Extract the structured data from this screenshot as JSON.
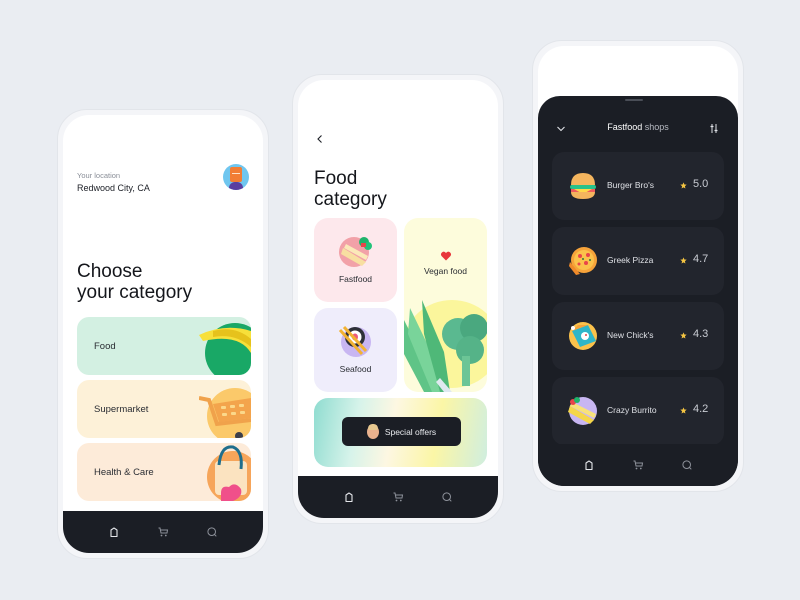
{
  "screens": {
    "home": {
      "location_label": "Your location",
      "location_value": "Redwood City, CA",
      "title_line1": "Choose",
      "title_line2": "your category",
      "categories": [
        {
          "label": "Food",
          "color": "#d3f0e2"
        },
        {
          "label": "Supermarket",
          "color": "#fdf1d8"
        },
        {
          "label": "Health & Care",
          "color": "#fdebd9"
        }
      ]
    },
    "food_category": {
      "title_line1": "Food",
      "title_line2": "category",
      "tiles": [
        {
          "label": "Fastfood",
          "color": "#fde8ec"
        },
        {
          "label": "Vegan food",
          "color": "#fdfcdc"
        },
        {
          "label": "Seafood",
          "color": "#efedfb"
        }
      ],
      "special_offers_label": "Special offers"
    },
    "fastfood_shops": {
      "header_bold": "Fastfood",
      "header_light": "shops",
      "shops": [
        {
          "name": "Burger Bro's",
          "rating": "5.0",
          "icon": "burger-icon"
        },
        {
          "name": "Greek Pizza",
          "rating": "4.7",
          "icon": "pizza-icon"
        },
        {
          "name": "New Chick's",
          "rating": "4.3",
          "icon": "chicken-box-icon"
        },
        {
          "name": "Crazy Burrito",
          "rating": "4.2",
          "icon": "burrito-icon"
        }
      ]
    }
  },
  "nav": {
    "items": [
      "home-icon",
      "cart-icon",
      "search-icon"
    ]
  },
  "colors": {
    "background": "#eaedf2",
    "dark": "#1b1e25",
    "card_dark": "#22252d",
    "star": "#f5c542",
    "heart": "#e8373a"
  }
}
